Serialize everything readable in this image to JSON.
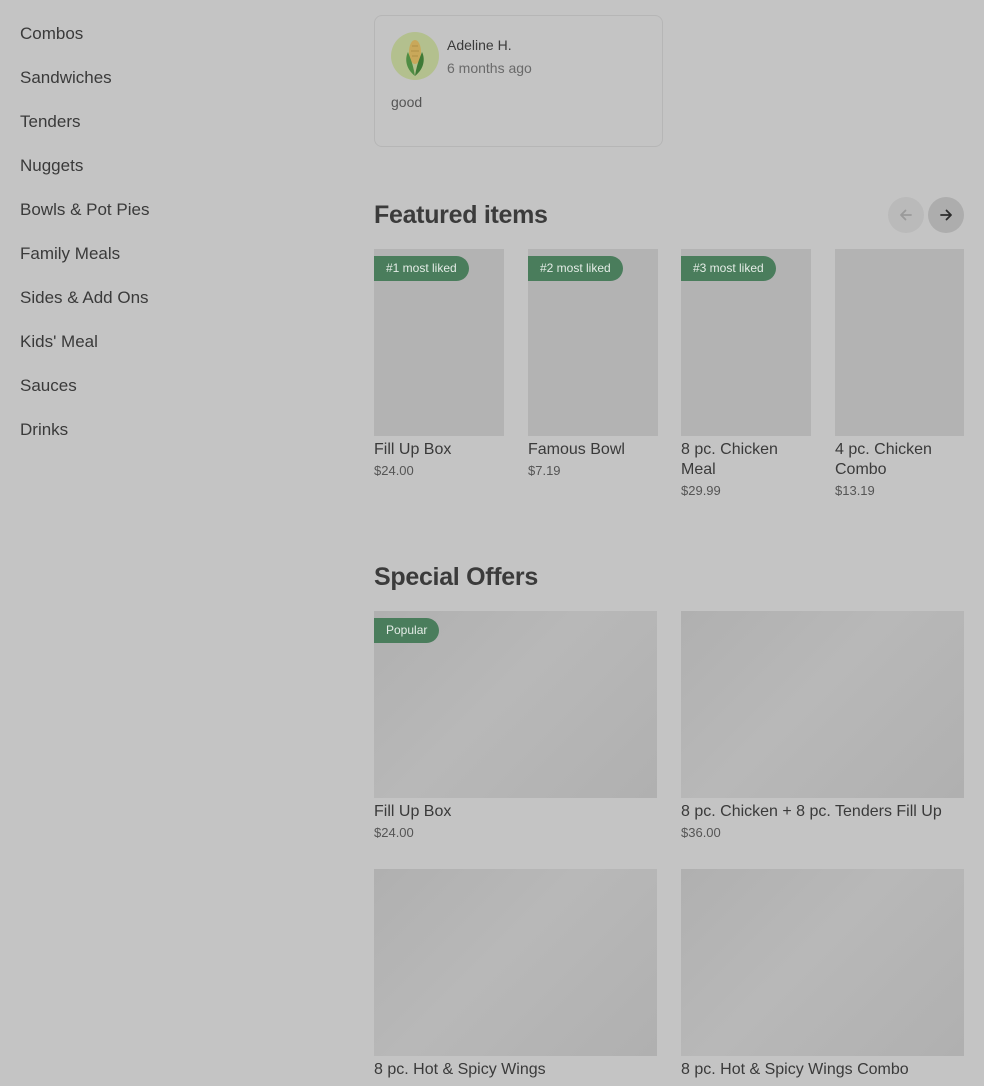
{
  "sidebar": {
    "items": [
      {
        "label": "Combos"
      },
      {
        "label": "Sandwiches"
      },
      {
        "label": "Tenders"
      },
      {
        "label": "Nuggets"
      },
      {
        "label": "Bowls & Pot Pies"
      },
      {
        "label": "Family Meals"
      },
      {
        "label": "Sides & Add Ons"
      },
      {
        "label": "Kids' Meal"
      },
      {
        "label": "Sauces"
      },
      {
        "label": "Drinks"
      }
    ]
  },
  "review": {
    "name": "Adeline H.",
    "time": "6 months ago",
    "text": "good",
    "avatar_icon": "corn-icon"
  },
  "featured": {
    "title": "Featured items",
    "prev_icon": "arrow-left-icon",
    "next_icon": "arrow-right-icon",
    "items": [
      {
        "badge": "#1 most liked",
        "name": "Fill Up Box",
        "price": "$24.00"
      },
      {
        "badge": "#2 most liked",
        "name": "Famous Bowl",
        "price": "$7.19"
      },
      {
        "badge": "#3 most liked",
        "name": "8 pc. Chicken Meal",
        "price": "$29.99"
      },
      {
        "badge": "",
        "name": "4 pc. Chicken Combo",
        "price": "$13.19"
      }
    ]
  },
  "offers": {
    "title": "Special Offers",
    "items": [
      {
        "badge": "Popular",
        "name": "Fill Up Box",
        "price": "$24.00"
      },
      {
        "badge": "",
        "name": "8 pc. Chicken + 8 pc. Tenders Fill Up",
        "price": "$36.00"
      },
      {
        "badge": "",
        "name": "8 pc. Hot & Spicy Wings",
        "price": ""
      },
      {
        "badge": "",
        "name": "8 pc. Hot & Spicy Wings Combo",
        "price": ""
      }
    ]
  },
  "colors": {
    "overlay_bg": "#c4c4c4",
    "badge_green": "#4a7d5c"
  }
}
